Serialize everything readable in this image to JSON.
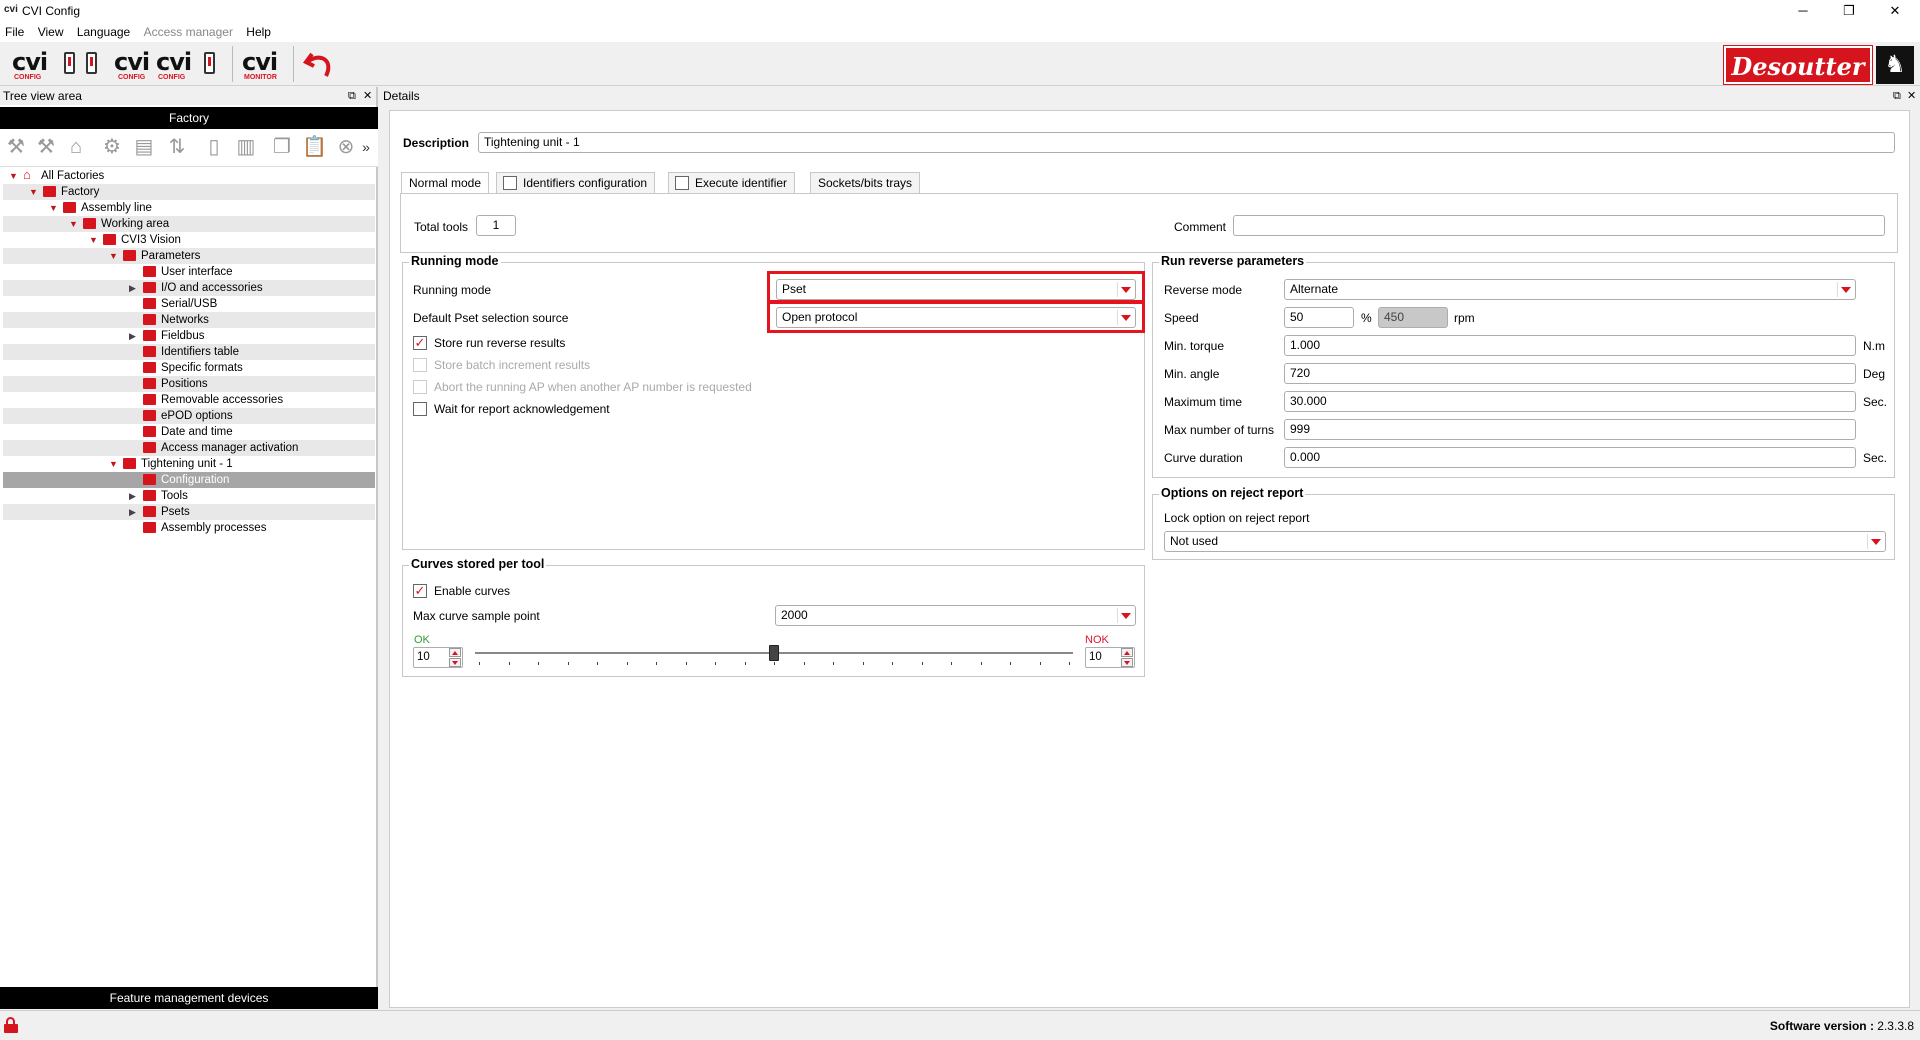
{
  "window": {
    "title": "CVI Config",
    "app_icon": "cvi",
    "minimize": "─",
    "maximize": "❐",
    "close": "✕"
  },
  "menu": {
    "items": [
      "File",
      "View",
      "Language",
      "Access manager",
      "Help"
    ]
  },
  "toolbar": {
    "cvi_config_label": "cvi",
    "config_sub": "CONFIG",
    "monitor_sub": "MONITOR",
    "brand": "Desoutter",
    "brand_icon": "horse-head-icon"
  },
  "tree_panel": {
    "title": "Tree view area",
    "factory_header": "Factory",
    "footer": "Feature management devices",
    "nodes": [
      {
        "label": "All Factories",
        "level": 0,
        "expanded": true
      },
      {
        "label": "Factory",
        "level": 1,
        "expanded": true
      },
      {
        "label": "Assembly line",
        "level": 2,
        "expanded": true
      },
      {
        "label": "Working area",
        "level": 3,
        "expanded": true
      },
      {
        "label": "CVI3 Vision",
        "level": 4,
        "expanded": true
      },
      {
        "label": "Parameters",
        "level": 5,
        "expanded": true
      },
      {
        "label": "User interface",
        "level": 6
      },
      {
        "label": "I/O and accessories",
        "level": 6,
        "collapsed": true
      },
      {
        "label": "Serial/USB",
        "level": 6
      },
      {
        "label": "Networks",
        "level": 6
      },
      {
        "label": "Fieldbus",
        "level": 6,
        "collapsed": true
      },
      {
        "label": "Identifiers table",
        "level": 6
      },
      {
        "label": "Specific formats",
        "level": 6
      },
      {
        "label": "Positions",
        "level": 6
      },
      {
        "label": "Removable accessories",
        "level": 6
      },
      {
        "label": "ePOD options",
        "level": 6
      },
      {
        "label": "Date and time",
        "level": 6
      },
      {
        "label": "Access manager activation",
        "level": 6
      },
      {
        "label": "Tightening unit - 1",
        "level": 5,
        "expanded": true
      },
      {
        "label": "Configuration",
        "level": 6,
        "selected": true
      },
      {
        "label": "Tools",
        "level": 6,
        "collapsed": true
      },
      {
        "label": "Psets",
        "level": 6,
        "collapsed": true
      },
      {
        "label": "Assembly processes",
        "level": 6
      }
    ]
  },
  "details": {
    "title": "Details",
    "description_label": "Description",
    "description_value": "Tightening unit - 1",
    "tabs": [
      "Normal mode",
      "Identifiers configuration",
      "Execute identifier",
      "Sockets/bits trays"
    ],
    "total_tools_label": "Total tools",
    "total_tools_value": "1",
    "comment_label": "Comment",
    "comment_value": "",
    "running_mode": {
      "title": "Running mode",
      "running_mode_label": "Running mode",
      "running_mode_value": "Pset",
      "default_source_label": "Default Pset selection source",
      "default_source_value": "Open protocol",
      "store_run_reverse": "Store run reverse results",
      "store_batch": "Store batch increment results",
      "abort_running": "Abort the running AP when another AP number is requested",
      "wait_ack": "Wait for report acknowledgement"
    },
    "run_reverse": {
      "title": "Run reverse parameters",
      "reverse_mode_label": "Reverse mode",
      "reverse_mode_value": "Alternate",
      "speed_label": "Speed",
      "speed_value": "50",
      "speed_pct": "%",
      "speed_rpm_value": "450",
      "speed_rpm_unit": "rpm",
      "min_torque_label": "Min. torque",
      "min_torque_value": "1.000",
      "min_torque_unit": "N.m",
      "min_angle_label": "Min. angle",
      "min_angle_value": "720",
      "min_angle_unit": "Deg",
      "max_time_label": "Maximum time",
      "max_time_value": "30.000",
      "max_time_unit": "Sec.",
      "max_turns_label": "Max number of turns",
      "max_turns_value": "999",
      "curve_duration_label": "Curve duration",
      "curve_duration_value": "0.000",
      "curve_duration_unit": "Sec."
    },
    "reject_report": {
      "title": "Options on reject report",
      "lock_label": "Lock option on reject report",
      "lock_value": "Not used"
    },
    "curves": {
      "title": "Curves stored per tool",
      "enable_curves": "Enable curves",
      "max_sample_label": "Max curve sample point",
      "max_sample_value": "2000",
      "ok_label": "OK",
      "ok_value": "10",
      "nok_label": "NOK",
      "nok_value": "10",
      "slider_fraction": 0.5
    }
  },
  "status": {
    "software_version_label": "Software version :",
    "software_version_value": "2.3.3.8"
  },
  "colors": {
    "accent_red": "#d6141e",
    "ok_green": "#2e9e2e",
    "nok_red": "#e0142c"
  }
}
